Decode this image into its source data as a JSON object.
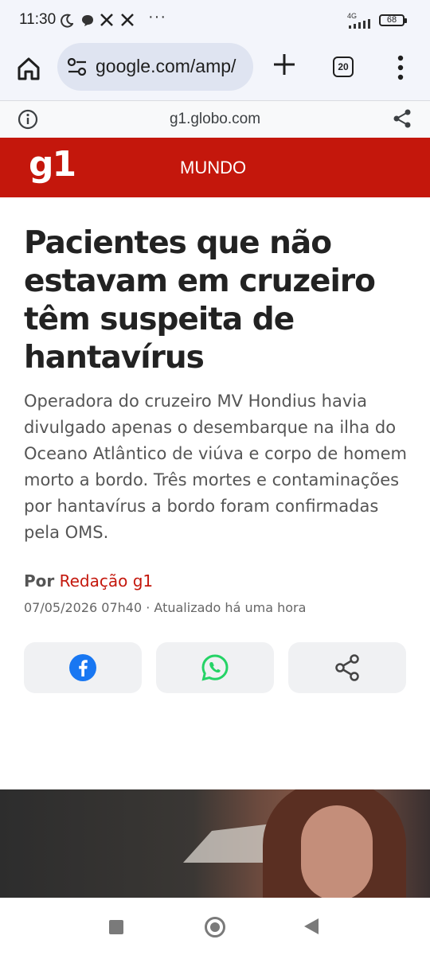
{
  "status_bar": {
    "time": "11:30",
    "network": "4G",
    "battery": "68"
  },
  "browser": {
    "url": "google.com/amp/",
    "tab_count": "20"
  },
  "amp_bar": {
    "domain": "g1.globo.com"
  },
  "site_header": {
    "logo": "g1",
    "section": "MUNDO",
    "brand_color": "#c4170c"
  },
  "article": {
    "title": "Pacientes que não estavam em cruzeiro têm suspeita de hantavírus",
    "lead": "Operadora do cruzeiro MV Hondius havia divulgado apenas o desembarque na ilha do Oceano Atlântico de viúva e corpo de homem morto a bordo. Três mortes e contaminações por hantavírus a bordo foram confirmadas pela OMS.",
    "by_prefix": "Por",
    "author": "Redação g1",
    "date": "07/05/2026 07h40 · Atualizado há uma hora"
  },
  "share_buttons": [
    {
      "icon": "facebook-icon",
      "color": "#1877f2"
    },
    {
      "icon": "whatsapp-icon",
      "color": "#25d366"
    },
    {
      "icon": "share-icon",
      "color": "#444444"
    }
  ]
}
